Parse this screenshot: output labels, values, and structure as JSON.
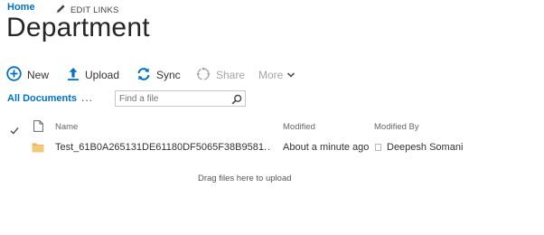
{
  "breadcrumb": {
    "home": "Home",
    "edit_links": "EDIT LINKS"
  },
  "page": {
    "title": "Department"
  },
  "toolbar": {
    "new": "New",
    "upload": "Upload",
    "sync": "Sync",
    "share": "Share",
    "more": "More"
  },
  "views": {
    "all_documents": "All Documents",
    "more": "..."
  },
  "search": {
    "placeholder": "Find a file"
  },
  "table": {
    "columns": {
      "name": "Name",
      "modified": "Modified",
      "modified_by": "Modified By"
    },
    "rows": [
      {
        "name": "Test_61B0A265131DE61180DF5065F38B9581",
        "modified": "About a minute ago",
        "modified_by": "Deepesh Somani",
        "more": "..."
      }
    ]
  },
  "drop_zone": {
    "message": "Drag files here to upload"
  },
  "colors": {
    "accent": "#0072c6",
    "folder": "#e8b765",
    "disabled": "#a6a6a6"
  },
  "icons": [
    "pencil-icon",
    "new-plus-icon",
    "upload-arrow-icon",
    "sync-icon",
    "share-icon",
    "chevron-down-icon",
    "search-icon",
    "checkmark-icon",
    "document-icon",
    "folder-icon",
    "presence-icon"
  ]
}
